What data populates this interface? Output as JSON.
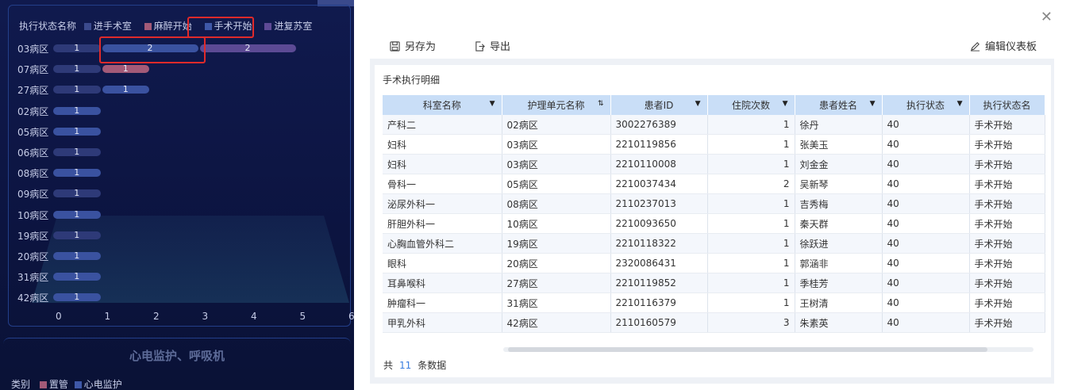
{
  "left": {
    "legend": {
      "title": "执行状态名称",
      "items": [
        {
          "label": "进手术室",
          "color": "#3b4a8c"
        },
        {
          "label": "麻醉开始",
          "color": "#a35a78"
        },
        {
          "label": "手术开始",
          "color": "#3f58a8"
        },
        {
          "label": "进复苏室",
          "color": "#5e4a96"
        }
      ]
    },
    "rows": [
      {
        "label": "03病区",
        "segments": [
          {
            "value": 1,
            "text": "1",
            "color": "#2e3a78"
          },
          {
            "value": 2,
            "text": "2",
            "color": "#3a52a0"
          },
          {
            "value": 2,
            "text": "2",
            "color": "#5c4a94"
          }
        ]
      },
      {
        "label": "07病区",
        "segments": [
          {
            "value": 1,
            "text": "1",
            "color": "#2e3a78"
          },
          {
            "value": 1,
            "text": "1",
            "color": "#a35a78"
          }
        ]
      },
      {
        "label": "27病区",
        "segments": [
          {
            "value": 1,
            "text": "1",
            "color": "#2e3a78"
          },
          {
            "value": 1,
            "text": "1",
            "color": "#3a52a0"
          }
        ]
      },
      {
        "label": "02病区",
        "segments": [
          {
            "value": 1,
            "text": "1",
            "color": "#3a52a0"
          }
        ]
      },
      {
        "label": "05病区",
        "segments": [
          {
            "value": 1,
            "text": "1",
            "color": "#3a52a0"
          }
        ]
      },
      {
        "label": "06病区",
        "segments": [
          {
            "value": 1,
            "text": "1",
            "color": "#2e3a78"
          }
        ]
      },
      {
        "label": "08病区",
        "segments": [
          {
            "value": 1,
            "text": "1",
            "color": "#3a52a0"
          }
        ]
      },
      {
        "label": "09病区",
        "segments": [
          {
            "value": 1,
            "text": "1",
            "color": "#2e3a78"
          }
        ]
      },
      {
        "label": "10病区",
        "segments": [
          {
            "value": 1,
            "text": "1",
            "color": "#3a52a0"
          }
        ]
      },
      {
        "label": "19病区",
        "segments": [
          {
            "value": 1,
            "text": "1",
            "color": "#2e3a78"
          }
        ]
      },
      {
        "label": "20病区",
        "segments": [
          {
            "value": 1,
            "text": "1",
            "color": "#3a52a0"
          }
        ]
      },
      {
        "label": "31病区",
        "segments": [
          {
            "value": 1,
            "text": "1",
            "color": "#3a52a0"
          }
        ]
      },
      {
        "label": "42病区",
        "segments": [
          {
            "value": 1,
            "text": "1",
            "color": "#3a52a0"
          }
        ]
      }
    ],
    "x_ticks": [
      "0",
      "1",
      "2",
      "3",
      "4",
      "5",
      "6"
    ],
    "bottom_title": "心电监护、呼吸机",
    "bottom_legend": {
      "title": "类别",
      "items": [
        {
          "label": "置管",
          "color": "#a35a78"
        },
        {
          "label": "心电监护",
          "color": "#3f58a8"
        }
      ]
    }
  },
  "modal": {
    "close_icon": "close-icon",
    "save_as_label": "另存为",
    "export_label": "导出",
    "edit_dashboard_label": "编辑仪表板",
    "panel_title": "手术执行明细",
    "columns": [
      "科室名称",
      "护理单元名称",
      "患者ID",
      "住院次数",
      "患者姓名",
      "执行状态",
      "执行状态名"
    ],
    "rows": [
      [
        "产科二",
        "02病区",
        "3002276389",
        "1",
        "徐丹",
        "40",
        "手术开始"
      ],
      [
        "妇科",
        "03病区",
        "2210119856",
        "1",
        "张美玉",
        "40",
        "手术开始"
      ],
      [
        "妇科",
        "03病区",
        "2210110008",
        "1",
        "刘金金",
        "40",
        "手术开始"
      ],
      [
        "骨科一",
        "05病区",
        "2210037434",
        "2",
        "吴新琴",
        "40",
        "手术开始"
      ],
      [
        "泌尿外科一",
        "08病区",
        "2110237013",
        "1",
        "吉秀梅",
        "40",
        "手术开始"
      ],
      [
        "肝胆外科一",
        "10病区",
        "2210093650",
        "1",
        "秦天群",
        "40",
        "手术开始"
      ],
      [
        "心胸血管外科二",
        "19病区",
        "2210118322",
        "1",
        "徐跃进",
        "40",
        "手术开始"
      ],
      [
        "眼科",
        "20病区",
        "2320086431",
        "1",
        "郭涵非",
        "40",
        "手术开始"
      ],
      [
        "耳鼻喉科",
        "27病区",
        "2210119852",
        "1",
        "季桂芳",
        "40",
        "手术开始"
      ],
      [
        "肿瘤科一",
        "31病区",
        "2210116379",
        "1",
        "王树清",
        "40",
        "手术开始"
      ],
      [
        "甲乳外科",
        "42病区",
        "2110160579",
        "3",
        "朱素英",
        "40",
        "手术开始"
      ]
    ],
    "footer": {
      "prefix": "共",
      "count": "11",
      "suffix": "条数据"
    }
  }
}
